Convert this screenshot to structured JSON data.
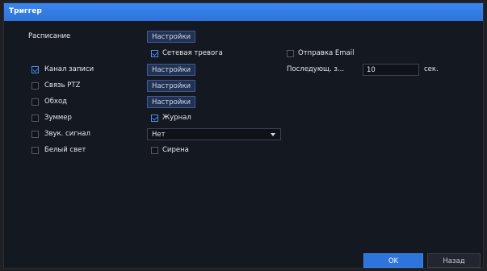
{
  "window": {
    "title": "Триггер"
  },
  "form": {
    "schedule": {
      "label": "Расписание",
      "button": "Настройки"
    },
    "network_alarm": {
      "label": "Сетевая тревога",
      "checked": true
    },
    "email": {
      "label": "Отправка Email",
      "checked": false
    },
    "record_channel": {
      "label": "Канал записи",
      "checked": true,
      "button": "Настройки"
    },
    "post_record": {
      "label": "Последующ. з...",
      "value": "10",
      "unit": "сек."
    },
    "ptz": {
      "label": "Связь PTZ",
      "checked": false,
      "button": "Настройки"
    },
    "tour": {
      "label": "Обход",
      "checked": false,
      "button": "Настройки"
    },
    "buzzer": {
      "label": "Зуммер",
      "checked": false
    },
    "log": {
      "label": "Журнал",
      "checked": true
    },
    "sound": {
      "label": "Звук. сигнал",
      "checked": false,
      "value": "Нет"
    },
    "white_light": {
      "label": "Белый свет",
      "checked": false
    },
    "siren": {
      "label": "Сирена",
      "checked": false
    }
  },
  "footer": {
    "ok_label": "OK",
    "back_label": "Назад"
  }
}
